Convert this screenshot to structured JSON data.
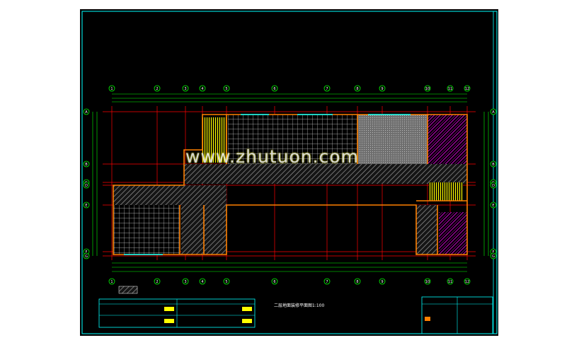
{
  "drawing": {
    "watermark": "www.zhutuon.com",
    "plan_title": "二层地面装修平面图1:100",
    "grid_labels_top": [
      "1",
      "2",
      "3",
      "4",
      "5",
      "6",
      "7",
      "8",
      "9",
      "10",
      "11",
      "12"
    ],
    "grid_labels_side": [
      "A",
      "B",
      "C",
      "D",
      "E",
      "F",
      "G"
    ]
  },
  "colors": {
    "background": "#000000",
    "frame": "#00ffff",
    "walls": "#ff8000",
    "axis": "#ff0000",
    "dimension": "#00ff00",
    "hatch_yellow": "#ffff00",
    "hatch_magenta": "#ff00ff",
    "hatch_gray": "#b4b4b4",
    "text": "#ffffff"
  }
}
